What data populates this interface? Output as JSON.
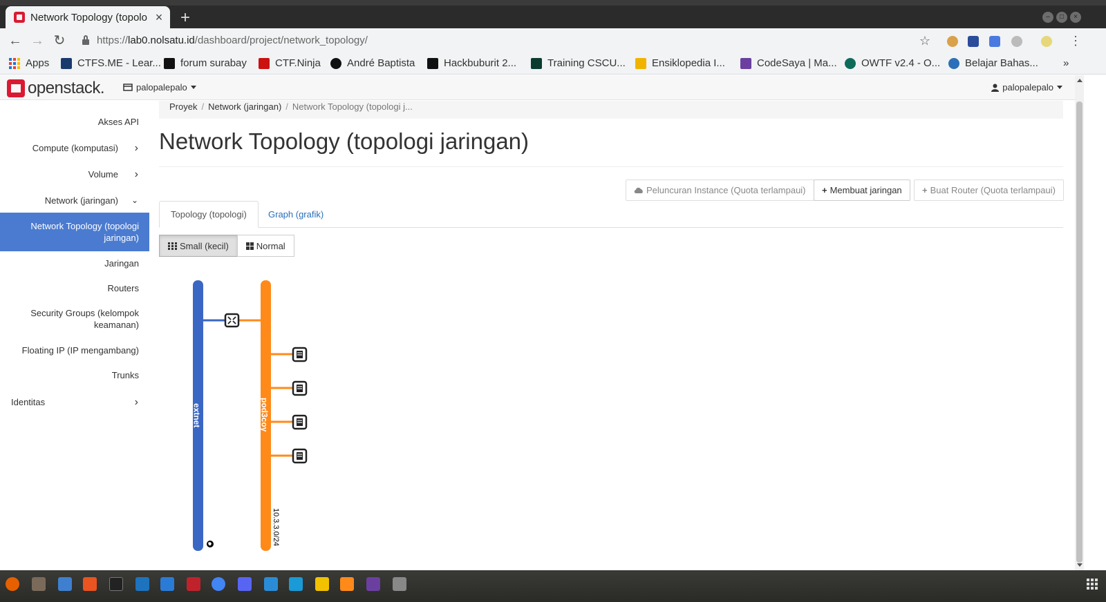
{
  "browser": {
    "tab_title": "Network Topology (topolo",
    "url_scheme": "https://",
    "url_host": "lab0.nolsatu.id",
    "url_path": "/dashboard/project/network_topology/",
    "bookmarks": [
      {
        "label": "Apps",
        "icon": "apps-grid-icon",
        "color": "#1a73e8"
      },
      {
        "label": "CTFS.ME - Lear...",
        "icon": "ctfs-icon",
        "color": "#1a3a6e"
      },
      {
        "label": "forum surabay",
        "icon": "forum-icon",
        "color": "#111111"
      },
      {
        "label": "CTF.Ninja",
        "icon": "ninja-icon",
        "color": "#cc1111"
      },
      {
        "label": "André Baptista",
        "icon": "andre-icon",
        "color": "#111111"
      },
      {
        "label": "Hackbuburit 2...",
        "icon": "hackbuburit-icon",
        "color": "#111111"
      },
      {
        "label": "Training CSCU...",
        "icon": "training-icon",
        "color": "#0b3d2e"
      },
      {
        "label": "Ensiklopedia I...",
        "icon": "ensiklopedia-icon",
        "color": "#f0b400"
      },
      {
        "label": "CodeSaya | Ma...",
        "icon": "codesaya-icon",
        "color": "#6b3fa0"
      },
      {
        "label": "OWTF v2.4 - O...",
        "icon": "owtf-icon",
        "color": "#0e6b5c"
      },
      {
        "label": "Belajar Bahas...",
        "icon": "belajar-icon",
        "color": "#2a6fb8"
      }
    ]
  },
  "header": {
    "brand": "openstack.",
    "project": "palopalepalo",
    "user": "palopalepalo"
  },
  "sidebar": {
    "items": [
      {
        "label": "Akses API"
      },
      {
        "label": "Compute (komputasi)"
      },
      {
        "label": "Volume"
      },
      {
        "label": "Network (jaringan)"
      },
      {
        "label": "Network Topology (topologi jaringan)"
      },
      {
        "label": "Jaringan"
      },
      {
        "label": "Routers"
      },
      {
        "label": "Security Groups (kelompok keamanan)"
      },
      {
        "label": "Floating IP (IP mengambang)"
      },
      {
        "label": "Trunks"
      },
      {
        "label": "Identitas"
      }
    ]
  },
  "main": {
    "breadcrumb": [
      "Proyek",
      "Network (jaringan)",
      "Network Topology (topologi j..."
    ],
    "title": "Network Topology (topologi jaringan)",
    "actions": {
      "launch": "Peluncuran Instance (Quota terlampaui)",
      "create_network": "Membuat jaringan",
      "create_router": "Buat Router (Quota terlampaui)"
    },
    "tabs": [
      "Topology (topologi)",
      "Graph (grafik)"
    ],
    "size_buttons": [
      "Small (kecil)",
      "Normal"
    ]
  },
  "topology": {
    "networks": [
      {
        "name": "extnet",
        "color": "#3b67c4",
        "cidr": ""
      },
      {
        "name": "pod3coy",
        "color": "#ff8a1a",
        "cidr": "10.3.3.0/24"
      }
    ],
    "router_count": 1,
    "instance_count": 4
  }
}
